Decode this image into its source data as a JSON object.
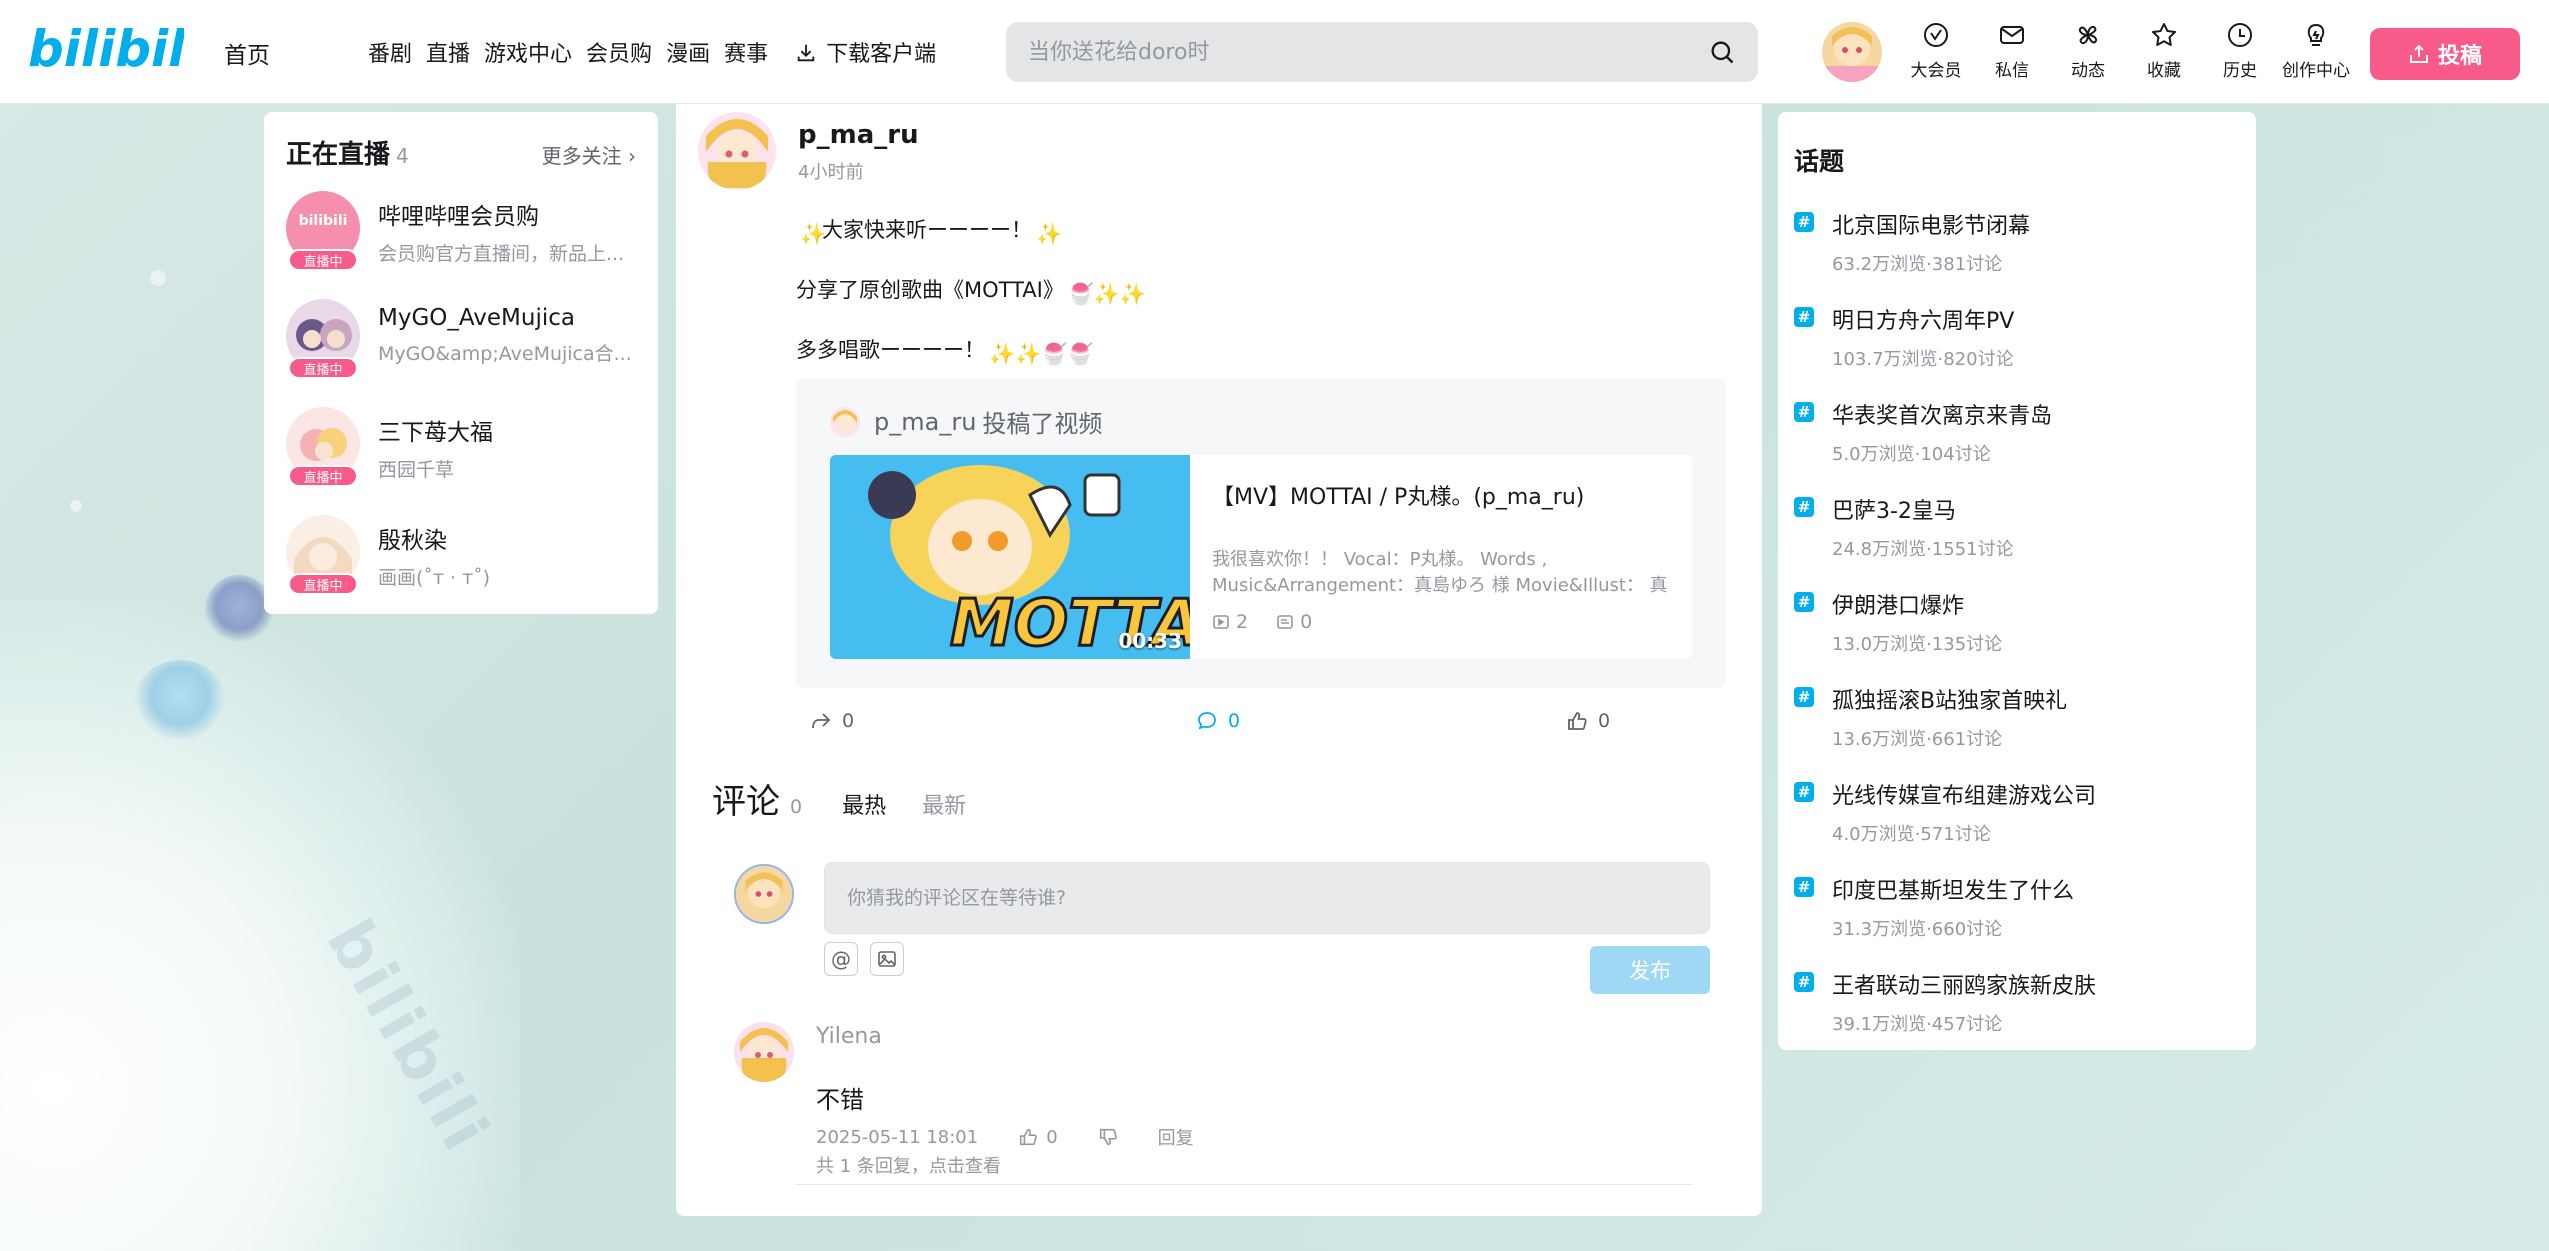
{
  "header": {
    "logo_text": "bilibili",
    "home": "首页",
    "nav": [
      "番剧",
      "直播",
      "游戏中心",
      "会员购",
      "漫画",
      "赛事"
    ],
    "download": "下载客户端",
    "search_placeholder": "当你送花给doro时",
    "icons": [
      {
        "icon": "vip-icon",
        "label": "大会员"
      },
      {
        "icon": "message-icon",
        "label": "私信"
      },
      {
        "icon": "dynamic-icon",
        "label": "动态"
      },
      {
        "icon": "star-icon",
        "label": "收藏"
      },
      {
        "icon": "history-icon",
        "label": "历史"
      },
      {
        "icon": "bulb-icon",
        "label": "创作中心"
      }
    ],
    "upload": "投稿"
  },
  "live": {
    "title": "正在直播",
    "count": "4",
    "more": "更多关注",
    "badge": "直播中",
    "items": [
      {
        "name": "哔哩哔哩会员购",
        "desc": "会员购官方直播间，新品上..."
      },
      {
        "name": "MyGO_AveMujica",
        "desc": "MyGO&amp;AveMujica合..."
      },
      {
        "name": "三下苺大福",
        "desc": "西园千草"
      },
      {
        "name": "殷秋染",
        "desc": "画画(˚т · т˚)"
      }
    ]
  },
  "post": {
    "author": "p_ma_ru",
    "time": "4小时前",
    "lines": [
      "大家快来听ーーーー！",
      "分享了原创歌曲《MOTTAI》",
      "多多唱歌ーーーー！"
    ],
    "repost_author": "p_ma_ru",
    "repost_action": "投稿了视频",
    "video": {
      "title": "【MV】MOTTAI / P丸様。(p_ma_ru)",
      "desc": "我很喜欢你！！ Vocal：P丸様。 Words , Music&Arrangement：真島ゆろ 様 Movie&Illust： 真島ゆ…",
      "duration": "00:33",
      "thumb_text": "MOTTAI",
      "plays": "2",
      "danmaku": "0"
    },
    "share": "0",
    "comment": "0",
    "like": "0"
  },
  "comments": {
    "title": "评论",
    "count": "0",
    "tab_hot": "最热",
    "tab_new": "最新",
    "input_placeholder": "你猜我的评论区在等待谁?",
    "at_symbol": "@",
    "post_btn": "发布",
    "reply": {
      "user": "Yilena",
      "text": "不错",
      "time": "2025-05-11 18:01",
      "likes": "0",
      "reply_label": "回复",
      "more": "共 1 条回复，点击查看"
    }
  },
  "topics": {
    "title": "话题",
    "items": [
      {
        "name": "北京国际电影节闭幕",
        "stat": "63.2万浏览·381讨论"
      },
      {
        "name": "明日方舟六周年PV",
        "stat": "103.7万浏览·820讨论"
      },
      {
        "name": "华表奖首次离京来青岛",
        "stat": "5.0万浏览·104讨论"
      },
      {
        "name": "巴萨3-2皇马",
        "stat": "24.8万浏览·1551讨论"
      },
      {
        "name": "伊朗港口爆炸",
        "stat": "13.0万浏览·135讨论"
      },
      {
        "name": "孤独摇滚B站独家首映礼",
        "stat": "13.6万浏览·661讨论"
      },
      {
        "name": "光线传媒宣布组建游戏公司",
        "stat": "4.0万浏览·571讨论"
      },
      {
        "name": "印度巴基斯坦发生了什么",
        "stat": "31.3万浏览·660讨论"
      },
      {
        "name": "王者联动三丽鸥家族新皮肤",
        "stat": "39.1万浏览·457讨论"
      }
    ]
  },
  "colors": {
    "accent": "#00aeec",
    "pink": "#f85a89"
  }
}
